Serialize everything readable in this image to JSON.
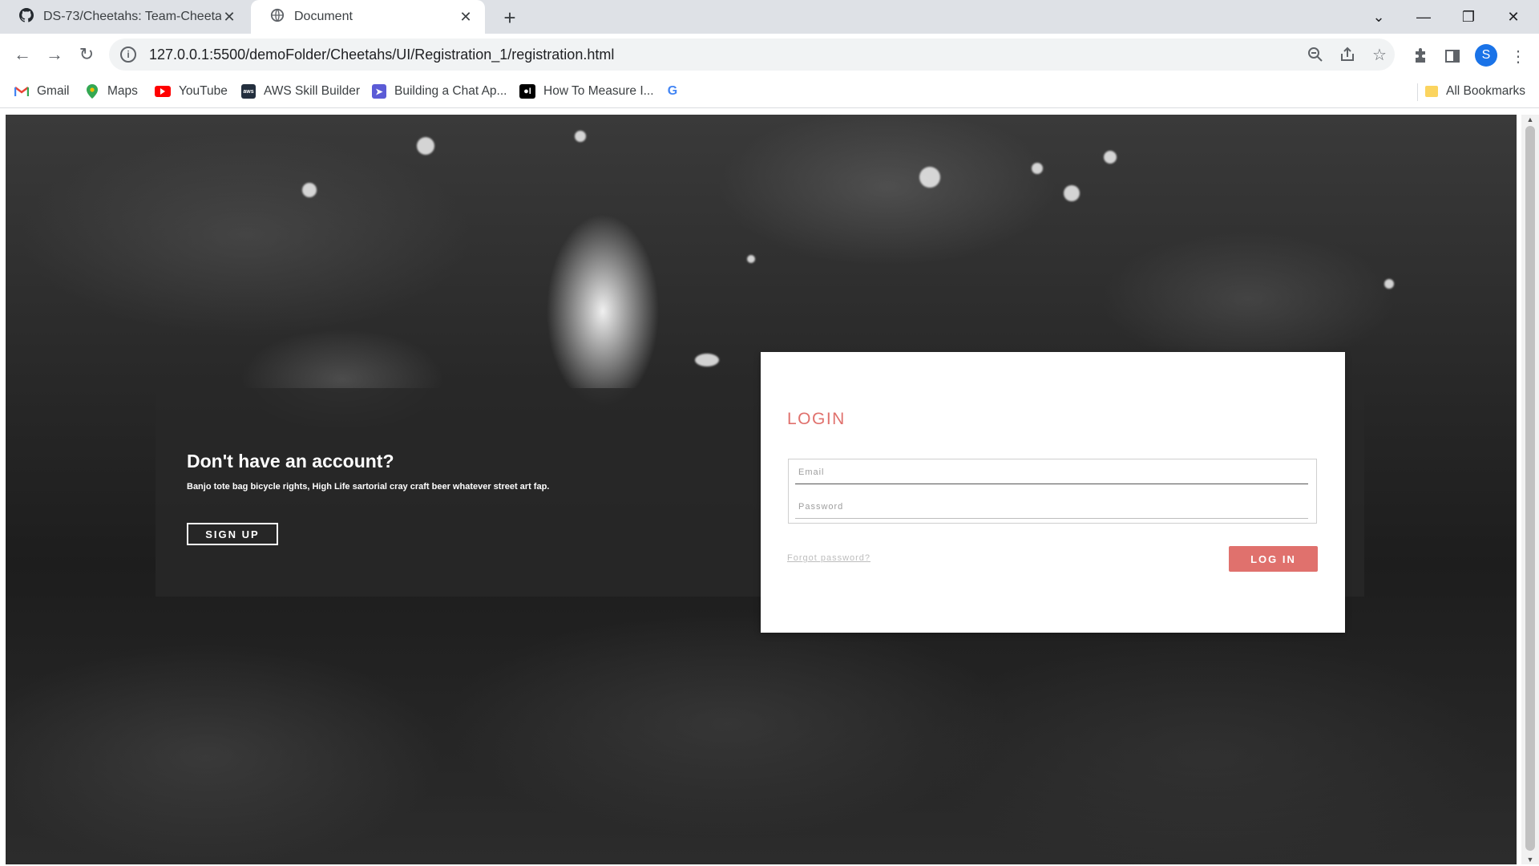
{
  "browser": {
    "tabs": [
      {
        "title": "DS-73/Cheetahs: Team-Cheetahs",
        "icon": "github-icon",
        "active": false
      },
      {
        "title": "Document",
        "icon": "globe-icon",
        "active": true
      }
    ],
    "new_tab_glyph": "+",
    "url": "127.0.0.1:5500/demoFolder/Cheetahs/UI/Registration_1/registration.html",
    "profile_initial": "S",
    "bookmarks": [
      {
        "label": "Gmail",
        "icon": "gmail-icon"
      },
      {
        "label": "Maps",
        "icon": "maps-icon"
      },
      {
        "label": "YouTube",
        "icon": "youtube-icon"
      },
      {
        "label": "AWS Skill Builder",
        "icon": "aws-icon"
      },
      {
        "label": "Building a Chat Ap...",
        "icon": "chat-app-icon"
      },
      {
        "label": "How To Measure I...",
        "icon": "medium-icon"
      },
      {
        "label": "",
        "icon": "google-icon"
      }
    ],
    "all_bookmarks_label": "All Bookmarks"
  },
  "page": {
    "signup": {
      "title": "Don't have an account?",
      "text": "Banjo tote bag bicycle rights, High Life sartorial cray craft beer whatever street art fap.",
      "button_label": "SIGN UP"
    },
    "login": {
      "title": "LOGIN",
      "email_placeholder": "Email",
      "password_placeholder": "Password",
      "forgot_label": "Forgot password?",
      "button_label": "LOG IN"
    }
  },
  "colors": {
    "accent": "#e0716d",
    "panel": "#282828",
    "tabstrip": "#dee1e6"
  }
}
